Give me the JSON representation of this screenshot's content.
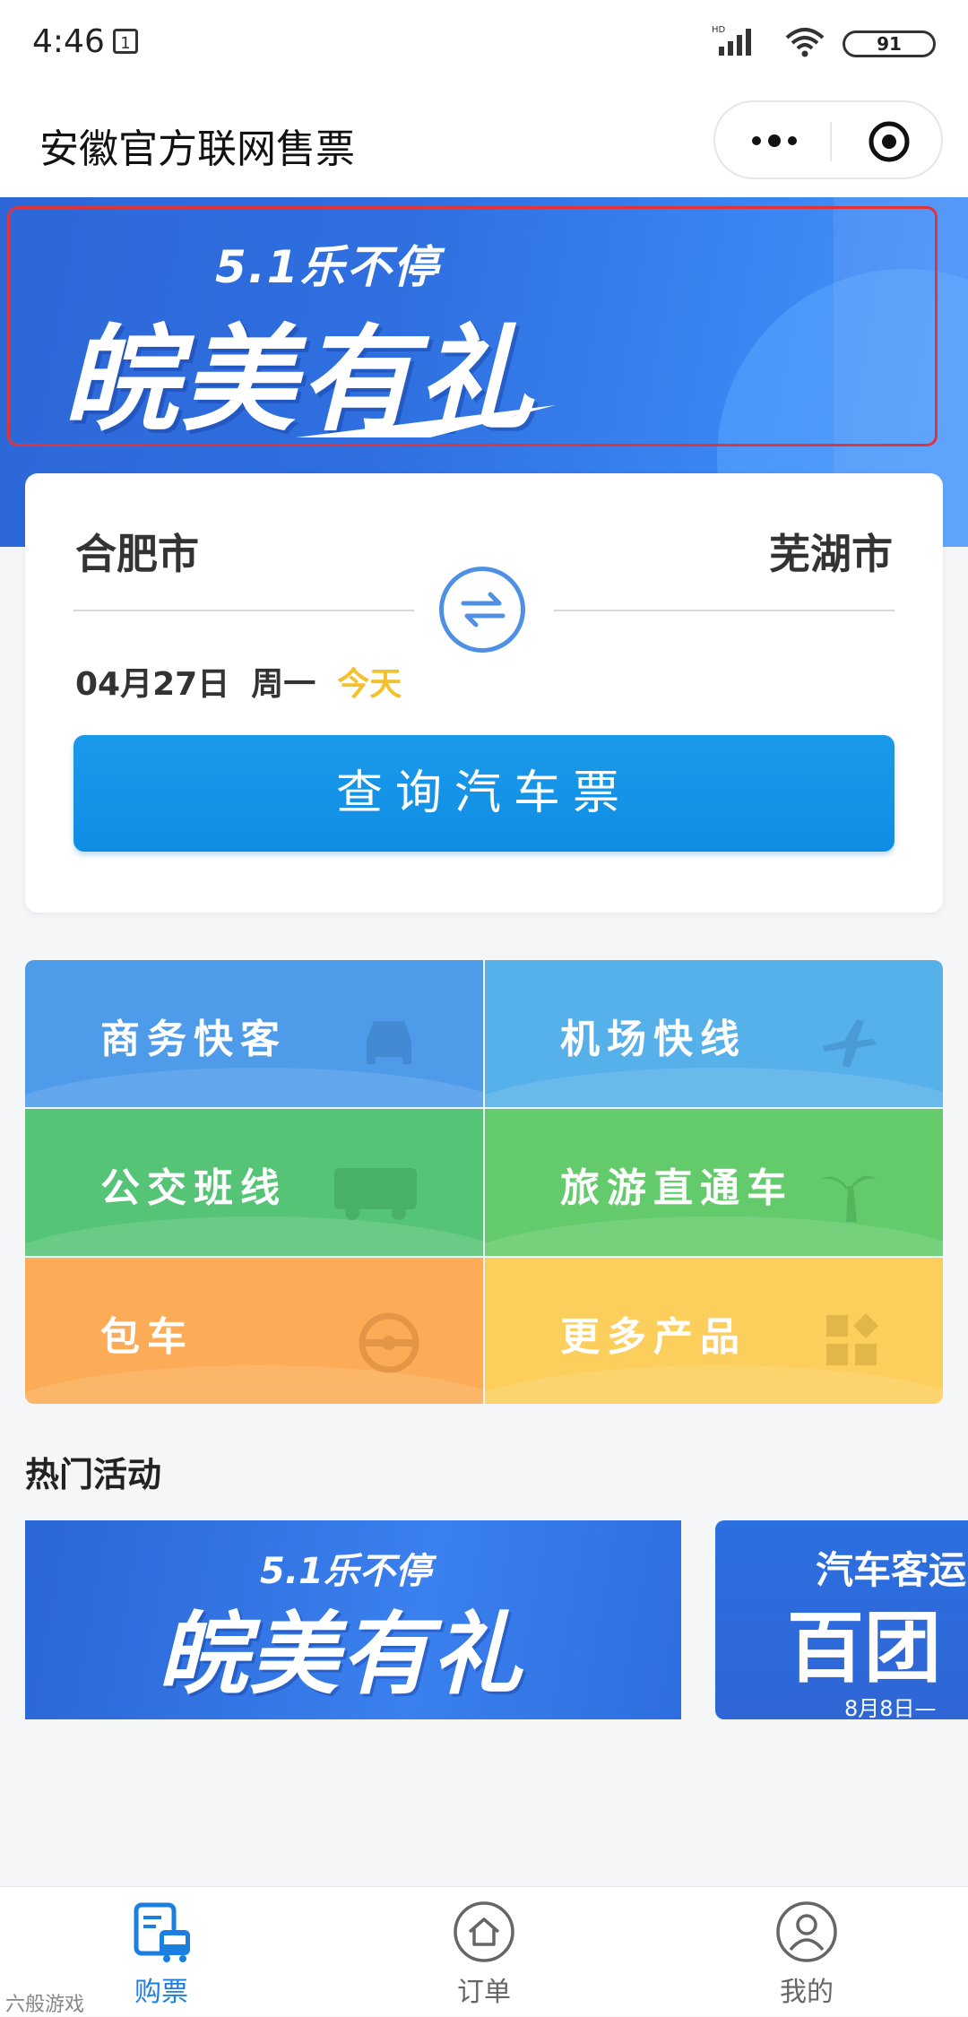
{
  "status_bar": {
    "time": "4:46",
    "calendar_day": "1",
    "network": "HD",
    "battery": "91"
  },
  "header": {
    "title": "安徽官方联网售票",
    "more_icon": "more-dots-icon",
    "target_icon": "target-icon"
  },
  "banner": {
    "subtitle": "5.1乐不停",
    "main": "皖美有礼",
    "colors": {
      "primary": "#2f6fe0",
      "frame": "#e0343c"
    }
  },
  "search": {
    "from": "合肥市",
    "to": "芜湖市",
    "date": "04月27日",
    "weekday": "周一",
    "relative": "今天",
    "button": "查询汽车票",
    "colors": {
      "accent": "#1b9aea",
      "today": "#f5c02a"
    }
  },
  "products": [
    {
      "label": "商务快客",
      "icon": "car-icon"
    },
    {
      "label": "机场快线",
      "icon": "airplane-icon"
    },
    {
      "label": "公交班线",
      "icon": "bus-icon"
    },
    {
      "label": "旅游直通车",
      "icon": "palm-tree-icon"
    },
    {
      "label": "包车",
      "icon": "steering-wheel-icon"
    },
    {
      "label": "更多产品",
      "icon": "grid-icon"
    }
  ],
  "hot": {
    "title": "热门活动",
    "card1": {
      "sub": "5.1乐不停",
      "main": "皖美有礼"
    },
    "card2": {
      "top": "汽车客运",
      "main": "百团",
      "date": "8月8日—"
    }
  },
  "nav": [
    {
      "label": "购票",
      "icon": "ticket-bus-icon",
      "active": true
    },
    {
      "label": "订单",
      "icon": "home-icon",
      "active": false
    },
    {
      "label": "我的",
      "icon": "user-icon",
      "active": false
    }
  ],
  "watermark": "六般游戏"
}
